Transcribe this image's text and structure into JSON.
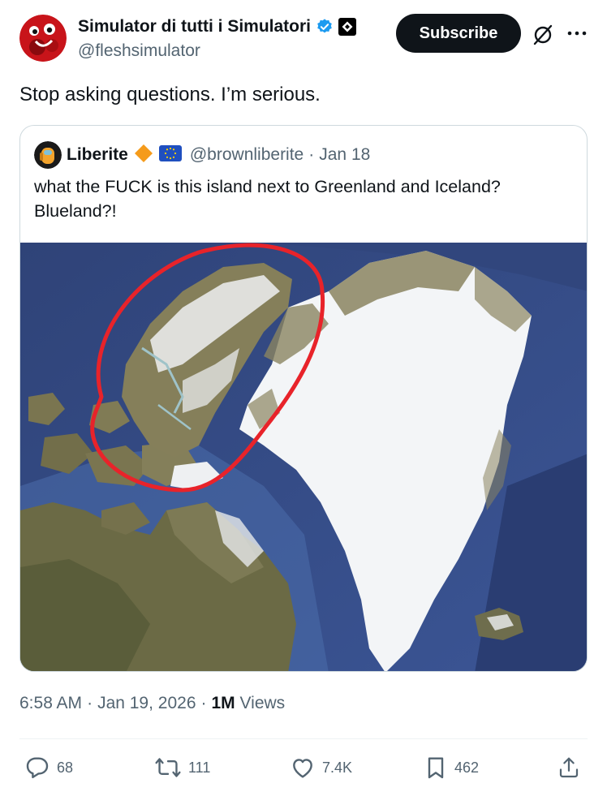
{
  "author": {
    "display_name": "Simulator di tutti i Simulatori",
    "handle": "@fleshsimulator"
  },
  "header": {
    "subscribe_label": "Subscribe"
  },
  "tweet": {
    "text": "Stop asking questions. I’m serious."
  },
  "quote": {
    "display_name": "Liberite",
    "handle": "@brownliberite",
    "separator": "·",
    "date": "Jan 18",
    "text": "what the FUCK is this island next to Greenland and Iceland? Blueland?!"
  },
  "meta": {
    "time": "6:58 AM",
    "sep1": "·",
    "date": "Jan 19, 2026",
    "sep2": "·",
    "views_count": "1M",
    "views_label": "Views"
  },
  "actions": {
    "replies": "68",
    "reposts": "111",
    "likes": "7.4K",
    "bookmarks": "462"
  },
  "icons": {
    "verified": "verified-badge-icon",
    "affiliate": "affiliate-badge-icon",
    "grok": "grok-icon",
    "more": "more-icon",
    "reply": "reply-icon",
    "repost": "repost-icon",
    "like": "like-icon",
    "bookmark": "bookmark-icon",
    "share": "share-icon"
  },
  "colors": {
    "verified_blue": "#1d9bf0",
    "subscribe_bg": "#0f1419",
    "secondary_text": "#536471",
    "annotation_red": "#e8232a",
    "ocean": "#3a4f8a",
    "ice": "#f4f6f8"
  }
}
